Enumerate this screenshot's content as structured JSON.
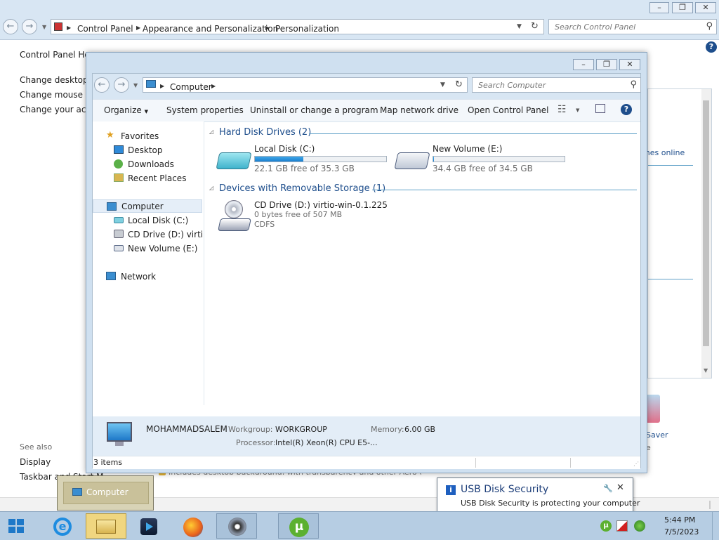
{
  "control_panel": {
    "breadcrumbs": [
      "Control Panel",
      "Appearance and Personalization",
      "Personalization"
    ],
    "search_placeholder": "Search Control Panel",
    "side_links": [
      "Control Panel Hom",
      "Change desktop ic",
      "Change mouse po",
      "Change your acco"
    ],
    "see_also_label": "See also",
    "see_also_links": [
      "Display",
      "Taskbar and Start M"
    ],
    "right_link": "mes online",
    "saver_label": "Saver",
    "bottom_partial": "Includes desktop background, with transparency and other Aero effects"
  },
  "computer_window": {
    "address": "Computer",
    "search_placeholder": "Search Computer",
    "toolbar": [
      "Organize",
      "System properties",
      "Uninstall or change a program",
      "Map network drive",
      "Open Control Panel"
    ],
    "nav": {
      "favorites": "Favorites",
      "favorite_items": [
        "Desktop",
        "Downloads",
        "Recent Places"
      ],
      "computer": "Computer",
      "computer_items": [
        "Local Disk (C:)",
        "CD Drive (D:) virtio-w",
        "New Volume (E:)"
      ],
      "network": "Network"
    },
    "groups": {
      "hdd_header": "Hard Disk Drives (2)",
      "removable_header": "Devices with Removable Storage (1)"
    },
    "drives": [
      {
        "name": "Local Disk (C:)",
        "free": "22.1 GB free of 35.3 GB",
        "used_fraction": 0.37
      },
      {
        "name": "New Volume (E:)",
        "free": "34.4 GB free of 34.5 GB",
        "used_fraction": 0.003
      }
    ],
    "cd_drive": {
      "name": "CD Drive (D:) virtio-win-0.1.225",
      "free": "0 bytes free of 507 MB",
      "fs": "CDFS"
    },
    "details": {
      "computer_name": "MOHAMMADSALEM",
      "workgroup_label": "Workgroup:",
      "workgroup": "WORKGROUP",
      "memory_label": "Memory:",
      "memory": "6.00 GB",
      "processor_label": "Processor:",
      "processor": "Intel(R) Xeon(R) CPU E5-..."
    },
    "status": "3 items"
  },
  "taskbar": {
    "thumbnail_label": "Computer",
    "time": "5:44 PM",
    "date": "7/5/2023"
  },
  "popup": {
    "title": "USB Disk Security",
    "message": "USB Disk Security is protecting your computer"
  },
  "colors": {
    "accent": "#1e4e8c",
    "taskbar": "#b6cde3",
    "progress": "#1b7fcf"
  }
}
